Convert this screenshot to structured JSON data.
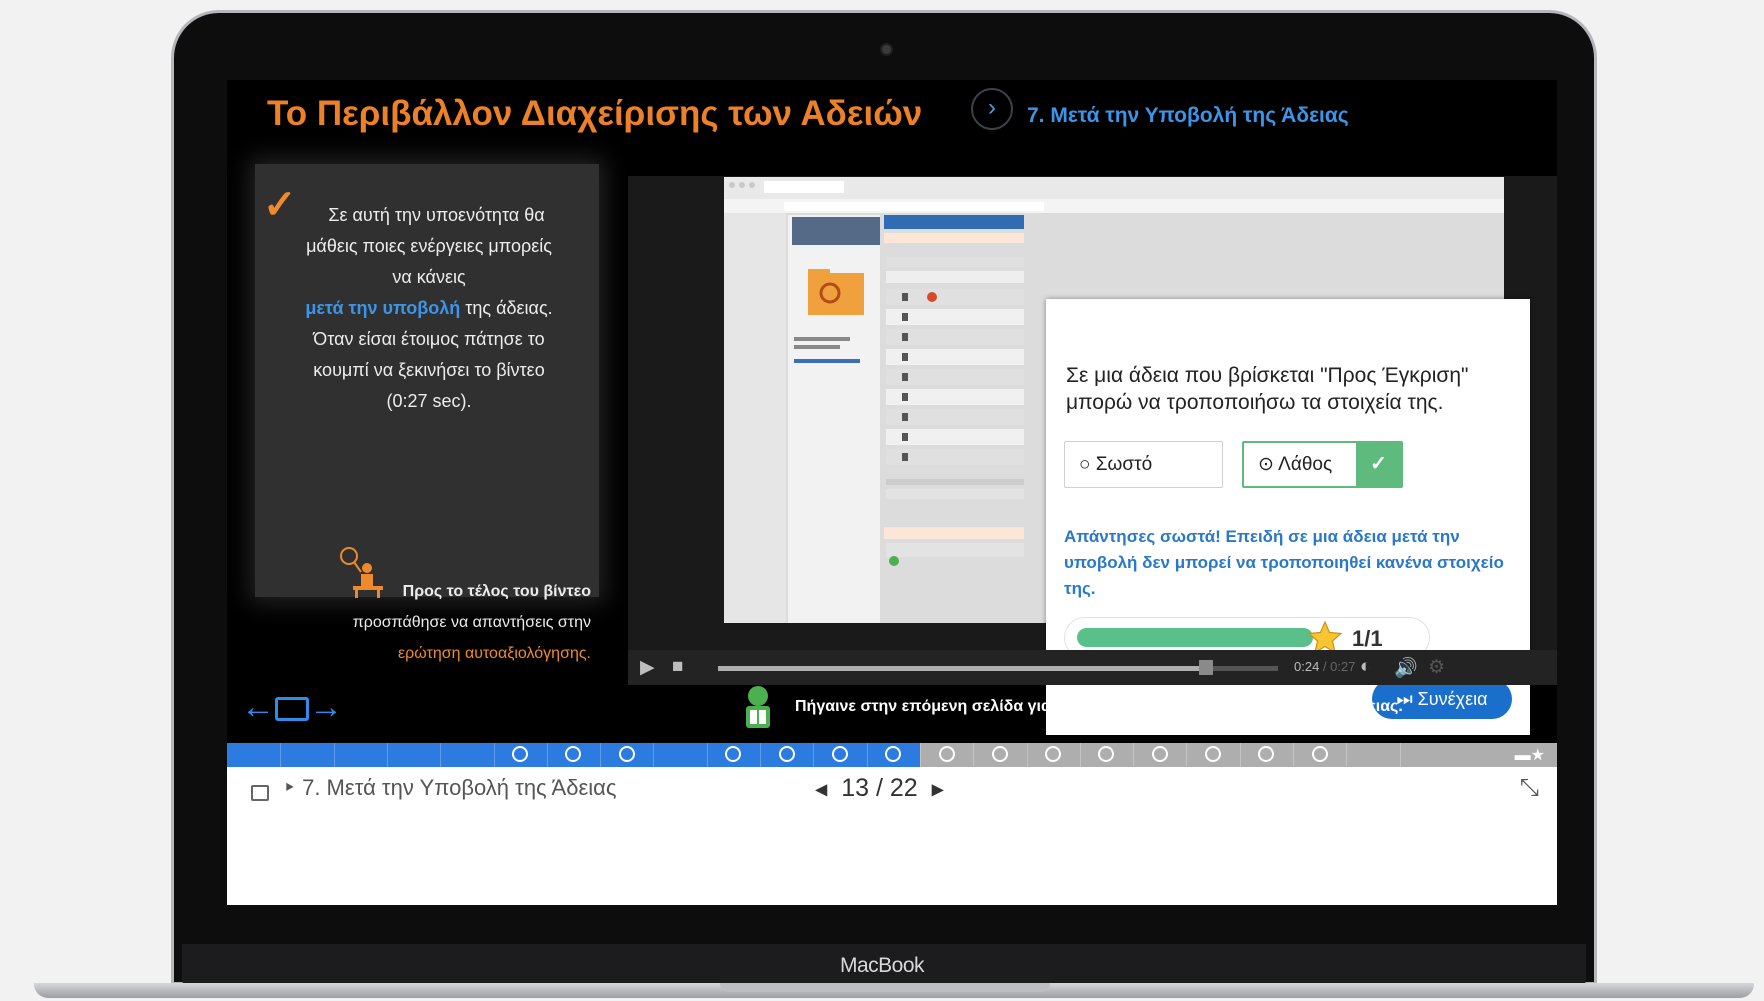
{
  "lesson": {
    "title": "Το Περιβάλλον Διαχείρισης των Αδειών",
    "subtitle": "7. Μετά την Υποβολή της Άδειας"
  },
  "info_box": {
    "line1": "Σε αυτή την υποενότητα θα",
    "line2": "μάθεις ποιες ενέργειες μπορείς",
    "line3": "να κάνεις",
    "highlight": "μετά την υποβολή",
    "line4_rest": " της άδειας.",
    "line5": "Όταν είσαι έτοιμος πάτησε το",
    "line6": "κουμπί να ξεκινήσει το βίντεο",
    "line7": "(0:27 sec).",
    "note_line1": "Προς το τέλος του βίντεο",
    "note_line2": "προσπάθησε να απαντήσεις στην",
    "note_link": "ερώτηση αυτοαξιολόγησης."
  },
  "quiz": {
    "question": "Σε μια άδεια που βρίσκεται \"Προς Έγκριση\" μπορώ να τροποποιήσω τα στοιχεία της.",
    "option_true": "Σωστό",
    "option_false": "Λάθος",
    "selected": "Λάθος",
    "feedback": "Απάντησες σωστά! Επειδή σε μια άδεια μετά την υποβολή δεν μπορεί να τροποποιηθεί κανένα στοιχείο της.",
    "score": "1/1",
    "score_fraction": 1.0,
    "continue_label": "Συνέχεια"
  },
  "video": {
    "time_current": "0:24",
    "time_total": "0:27",
    "progress_fraction": 0.87
  },
  "footer_nav": {
    "next_hint": "Πήγαινε στην επόμενη σελίδα για να μάθεις τη διαδικασία έγκρισης μιας άδειας."
  },
  "progress": {
    "current_page": 13,
    "total_pages": 22
  },
  "bottom_bar": {
    "breadcrumb": "7. Μετά την Υποβολή της Άδειας",
    "page_current": "13",
    "page_separator": "/",
    "page_total": "22"
  },
  "device": {
    "brand": "MacBook"
  },
  "colors": {
    "accent_orange": "#ec8128",
    "accent_blue": "#3b95e8",
    "correct_green": "#5fba7d",
    "button_blue": "#1a6ecc"
  }
}
